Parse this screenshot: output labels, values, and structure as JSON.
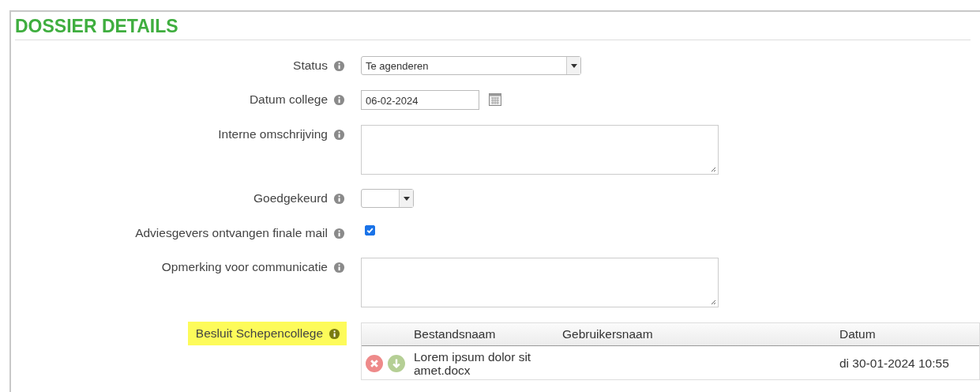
{
  "panel": {
    "title": "DOSSIER DETAILS"
  },
  "fields": [
    {
      "kind": "select",
      "label": "Status",
      "value": "Te agenderen",
      "highlighted": false
    },
    {
      "kind": "date",
      "label": "Datum college",
      "value": "06-02-2024",
      "highlighted": false
    },
    {
      "kind": "textarea",
      "label": "Interne omschrijving",
      "highlighted": false
    },
    {
      "kind": "select",
      "label": "Goedgekeurd",
      "highlighted": false
    },
    {
      "kind": "checkbox",
      "label": "Adviesgevers ontvangen finale mail",
      "checked": true,
      "highlighted": false
    },
    {
      "kind": "textarea",
      "label": "Opmerking voor communicatie",
      "highlighted": false
    },
    {
      "kind": "files",
      "label": "Besluit Schepencollege",
      "highlighted": true,
      "columns": [
        "Bestandsnaam",
        "Gebruikersnaam",
        "Datum"
      ],
      "rows": [
        {
          "name": "Lorem ipsum dolor sit amet.docx",
          "date": "di 30-01-2024 10:55"
        }
      ]
    }
  ]
}
